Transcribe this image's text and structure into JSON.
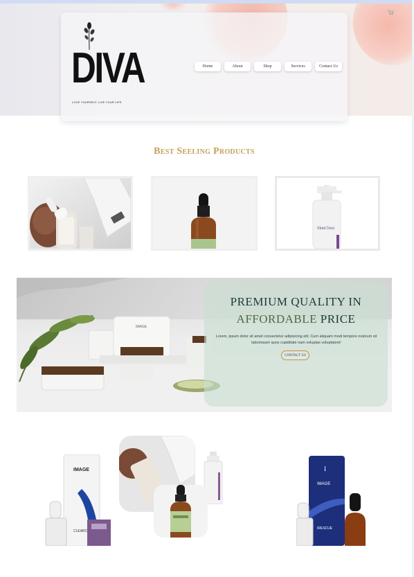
{
  "brand": {
    "logo_text": "DIVA",
    "tagline": "LOVE YOURSELF, LIVE YOUR LIFE"
  },
  "nav": {
    "items": [
      "Home",
      "About",
      "Shop",
      "Services",
      "Contact Us"
    ]
  },
  "icons": {
    "cart": "cart-icon"
  },
  "best_selling": {
    "title": "Best Seeling Products",
    "products": [
      {
        "image": "skincare-bottle-with-box"
      },
      {
        "image": "amber-dropper-bottle"
      },
      {
        "image": "white-pump-bottle"
      }
    ],
    "pump_label": "SkinClinic"
  },
  "banner": {
    "headline_line1": "PREMIUM QUALITY IN",
    "headline_accent": "AFFORDABLE",
    "headline_rest": " PRICE",
    "body": "Lorem, ipsum dolor sit amet consectetur adipisicing elit. Cum aliquam modi tempore nostrum sit laboriosam quos cupiditate nam voluptas voluptatem!",
    "button": "CONTACT US",
    "jar_label": "IMAGE"
  },
  "gallery": {
    "left_bottle_label": "IMAGE",
    "left_bottle_sub": "CLEARCELL",
    "right_bottle_label": "IMAGE",
    "right_bottle_sub": "IRESCUE"
  },
  "colors": {
    "gold": "#c2a15a",
    "banner_text": "#1a3a34",
    "accent_green": "#4e6a3d",
    "button_border": "#c8903c"
  }
}
